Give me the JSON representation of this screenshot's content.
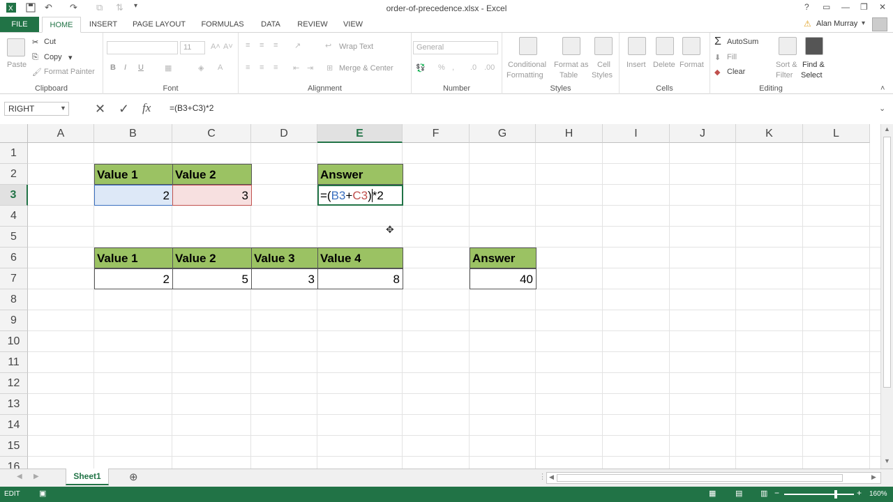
{
  "window": {
    "title": "order-of-precedence.xlsx - Excel",
    "help": "?",
    "user": "Alan Murray"
  },
  "tabs": [
    "FILE",
    "HOME",
    "INSERT",
    "PAGE LAYOUT",
    "FORMULAS",
    "DATA",
    "REVIEW",
    "VIEW"
  ],
  "ribbon": {
    "clipboard": {
      "paste": "Paste",
      "cut": "Cut",
      "copy": "Copy",
      "format_painter": "Format Painter",
      "label": "Clipboard"
    },
    "font": {
      "size": "11",
      "label": "Font",
      "bold": "B",
      "italic": "I",
      "underline": "U"
    },
    "alignment": {
      "wrap": "Wrap Text",
      "merge": "Merge & Center",
      "label": "Alignment"
    },
    "number": {
      "format": "General",
      "label": "Number",
      "percent": "%"
    },
    "styles": {
      "cond1": "Conditional",
      "cond2": "Formatting",
      "table1": "Format as",
      "table2": "Table",
      "cell1": "Cell",
      "cell2": "Styles",
      "label": "Styles"
    },
    "cells": {
      "insert": "Insert",
      "delete": "Delete",
      "format": "Format",
      "label": "Cells"
    },
    "editing": {
      "autosum": "AutoSum",
      "fill": "Fill",
      "clear": "Clear",
      "sort1": "Sort &",
      "sort2": "Filter",
      "find1": "Find &",
      "find2": "Select",
      "label": "Editing",
      "sigma": "Σ"
    }
  },
  "formula_bar": {
    "name_box": "RIGHT",
    "formula": "=(B3+C3)*2",
    "fx": "fx"
  },
  "columns": [
    "A",
    "B",
    "C",
    "D",
    "E",
    "F",
    "G",
    "H",
    "I",
    "J",
    "K",
    "L"
  ],
  "rows": [
    "1",
    "2",
    "3",
    "4",
    "5",
    "6",
    "7",
    "8",
    "9",
    "10",
    "11",
    "12",
    "13",
    "14",
    "15",
    "16"
  ],
  "cells": {
    "B2": "Value 1",
    "C2": "Value 2",
    "E2": "Answer",
    "B3": "2",
    "C3": "3",
    "E3": {
      "p1": "=(",
      "b": "B3",
      "plus": "+",
      "c": "C3",
      "p2": ")",
      "p3": "*2"
    },
    "B6": "Value 1",
    "C6": "Value 2",
    "D6": "Value 3",
    "E6": "Value 4",
    "G6": "Answer",
    "B7": "2",
    "C7": "5",
    "D7": "3",
    "E7": "8",
    "G7": "40"
  },
  "sheet": {
    "name": "Sheet1"
  },
  "status": {
    "mode": "EDIT",
    "zoom": "160%"
  },
  "colors": {
    "accent": "#217346",
    "header_fill": "#9bc263"
  }
}
